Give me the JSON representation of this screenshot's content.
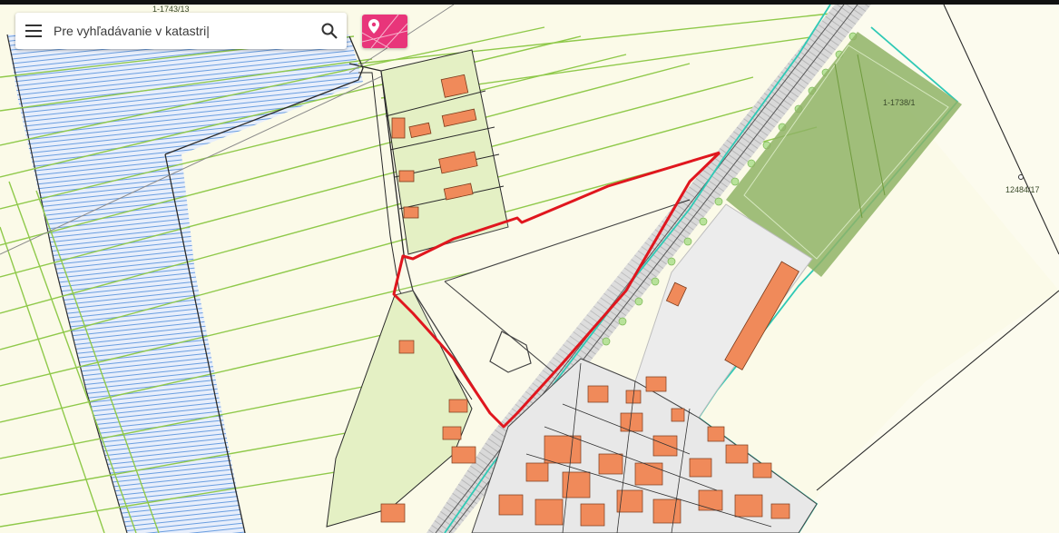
{
  "search": {
    "placeholder": "Pre vyhľadávanie v katastri|"
  },
  "map": {
    "parcel_labels": {
      "top_left": "1-1743/13",
      "green_field": "1-1738/1",
      "right": "12484/17"
    },
    "colors": {
      "background": "#fbfae8",
      "parcel_lines": "#8fc94a",
      "water_hatch": "#6a9ee0",
      "highlight_boundary": "#e0161e",
      "railway_boundary": "#2ec9b5",
      "buildings": "#f08a5a",
      "garden_green": "#e4f0c4",
      "field_green": "#7fa85a"
    }
  },
  "toolbar": {
    "menu_icon": "menu-icon",
    "search_icon": "search-icon",
    "layer_icon": "map-pin-layer-icon",
    "layer_color": "#e8357a"
  }
}
